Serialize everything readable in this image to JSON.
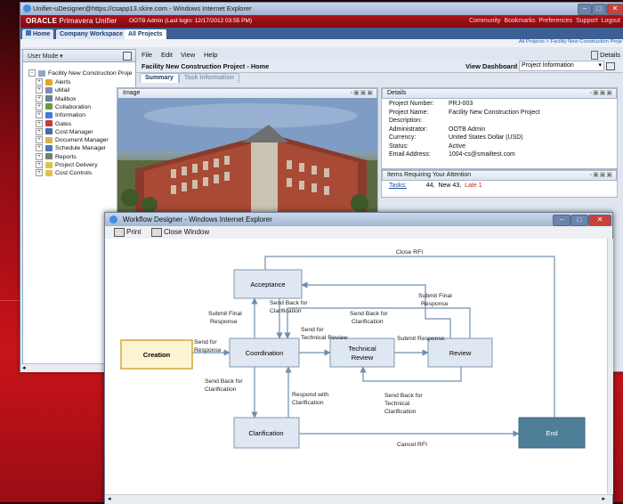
{
  "main_window": {
    "title": "Unifier-uDesigner@https://csapp13.skire.com - Windows Internet Explorer",
    "oracle_brand": "ORACLE",
    "app_name": "Primavera Unifier",
    "user_info": "OOTB Admin (Last login: 12/17/2012 03:55 PM)",
    "header_links": "Community  Bookmarks  Preferences  Support  Logout",
    "tabs": [
      {
        "label": "Home"
      },
      {
        "label": "Company Workspace"
      },
      {
        "label": "All Projects"
      }
    ],
    "breadcrumb": "All Projects > Facility New Construction Proje"
  },
  "left_panel": {
    "user_mode": "User Mode",
    "root": "Facility New Construction Proje",
    "items": [
      {
        "label": "Alerts",
        "color": "#e0a81c"
      },
      {
        "label": "uMail",
        "color": "#7a8fb3"
      },
      {
        "label": "Mailbox",
        "color": "#6f7f96"
      },
      {
        "label": "Collaboration",
        "color": "#6a9a3c"
      },
      {
        "label": "Information",
        "color": "#3d7fd1"
      },
      {
        "label": "Gates",
        "color": "#c43c3c"
      },
      {
        "label": "Cost Manager",
        "color": "#3d6fa8"
      },
      {
        "label": "Document Manager",
        "color": "#d8b44a"
      },
      {
        "label": "Schedule Manager",
        "color": "#4a78b8"
      },
      {
        "label": "Reports",
        "color": "#7a7a7a"
      },
      {
        "label": "Project Delivery",
        "color": "#e2c24a"
      },
      {
        "label": "Cost Controls",
        "color": "#e2c24a"
      }
    ]
  },
  "menu": {
    "items": [
      "File",
      "Edit",
      "View",
      "Help"
    ],
    "details": "Details"
  },
  "project": {
    "title": "Facility New Construction Project - Home",
    "view_dashboard": "View Dashboard",
    "dashboard_value": "Project Information",
    "tabs": [
      "Summary",
      "Task Information"
    ]
  },
  "image_panel": {
    "title": "Image"
  },
  "details_panel": {
    "title": "Details",
    "rows": [
      {
        "label": "Project Number:",
        "value": "PRJ-003"
      },
      {
        "label": "Project Name:",
        "value": "Facility New Construction Project"
      },
      {
        "label": "Description:",
        "value": ""
      },
      {
        "label": "Administrator:",
        "value": "OOTB Admin"
      },
      {
        "label": "Currency:",
        "value": "United States Dollar (USD)"
      },
      {
        "label": "Status:",
        "value": "Active"
      },
      {
        "label": "Email Address:",
        "value": "1004-cs@smailtest.com"
      }
    ]
  },
  "items_panel": {
    "title": "Items Requiring Your Attention",
    "tasks_label": "Tasks:",
    "tasks_count": "44,",
    "new_count": "New 43,",
    "late_count": "Late  1"
  },
  "workflow_window": {
    "title": "Workflow Designer - Windows Internet Explorer",
    "print": "Print",
    "close_window": "Close Window",
    "nodes": {
      "creation": "Creation",
      "acceptance": "Acceptance",
      "coordination": "Coordination",
      "technical_review_1": "Technical",
      "technical_review_2": "Review",
      "review": "Review",
      "clarification": "Clarification",
      "end": "End"
    },
    "labels": {
      "close_rfi": "Close RFI",
      "submit_final_response_top_1": "Submit Final",
      "submit_final_response_top_2": "Response",
      "submit_final_response_left_1": "Submit Final",
      "submit_final_response_left_2": "Response",
      "send_back_clarif_1": "Send Back for",
      "send_back_clarif_2": "Clarification",
      "send_back_clarif_right_1": "Send Back for",
      "send_back_clarif_right_2": "Clarification",
      "send_for_tech_review_1": "Send for",
      "send_for_tech_review_2": "Technical Review",
      "submit_response": "Submit Response",
      "send_for_response_1": "Send for",
      "send_for_response_2": "Response",
      "send_back_clarif_low_1": "Send Back for",
      "send_back_clarif_low_2": "Clarification",
      "respond_with_clarif_1": "Respond with",
      "respond_with_clarif_2": "Clarification",
      "send_back_tech_1": "Send Back for",
      "send_back_tech_2": "Technical",
      "send_back_tech_3": "Clarification",
      "cancel_rfi": "Cancel RFI"
    }
  },
  "colors": {
    "node_fill": "#dfe8f2",
    "node_border": "#7f97b3",
    "creation_fill": "#fdf4d2",
    "creation_border": "#d4a83a",
    "end_fill": "#4f7e98",
    "arrow": "#6f8fb0"
  }
}
